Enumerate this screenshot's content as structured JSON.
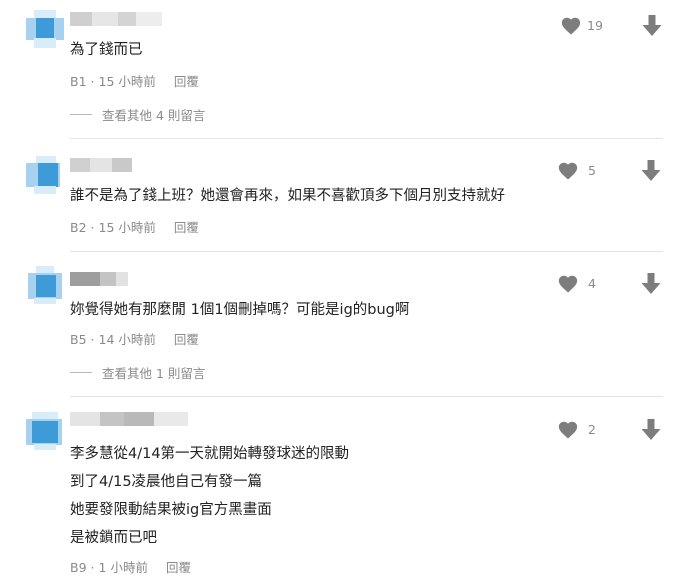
{
  "comments": [
    {
      "text_lines": [
        "為了錢而已"
      ],
      "floor": "B1",
      "time": "15 小時前",
      "reply_label": "回覆",
      "likes": "19",
      "more_replies": "查看其他 4 則留言"
    },
    {
      "text_lines": [
        "誰不是為了錢上班？她還會再來，如果不喜歡頂多下個月別支持就好"
      ],
      "floor": "B2",
      "time": "15 小時前",
      "reply_label": "回覆",
      "likes": "5"
    },
    {
      "text_lines": [
        "妳覺得她有那麼閒 1個1個刪掉嗎？可能是ig的bug啊"
      ],
      "floor": "B5",
      "time": "14 小時前",
      "reply_label": "回覆",
      "likes": "4",
      "more_replies": "查看其他 1 則留言"
    },
    {
      "text_lines": [
        "李多慧從4/14第一天就開始轉發球迷的限動",
        "到了4/15凌晨他自己有發一篇",
        "她要發限動結果被ig官方黑畫面",
        "是被鎖而已吧"
      ],
      "floor": "B9",
      "time": "1 小時前",
      "reply_label": "回覆",
      "likes": "2"
    }
  ],
  "colors": {
    "icon": "#7d7d7d",
    "avatar_blue": "#3f9ad8",
    "avatar_light": "#a6d2ef"
  },
  "icons": {
    "like": "heart-icon",
    "dislike": "arrow-down-icon"
  }
}
